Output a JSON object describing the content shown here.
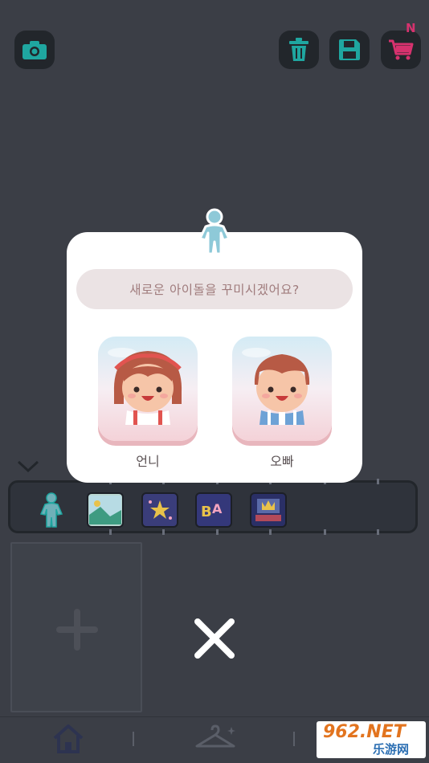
{
  "toolbar": {
    "camera_icon": "camera-icon",
    "trash_icon": "trash-icon",
    "save_icon": "floppy-disk-icon",
    "cart_icon": "shopping-cart-icon",
    "cart_badge": "N",
    "accent_camera": "#1fa6a0",
    "accent_cart": "#d6326e"
  },
  "modal": {
    "question": "새로운 아이돌을 꾸미시겠어요?",
    "options": [
      {
        "label": "언니",
        "avatar": "girl-avatar-icon"
      },
      {
        "label": "오빠",
        "avatar": "boy-avatar-icon"
      }
    ]
  },
  "tray": {
    "items": [
      "figure-icon",
      "background-image-icon",
      "stars-icon",
      "letters-icon",
      "stage-icon"
    ]
  },
  "close_icon": "close-icon",
  "bottom_nav": {
    "items": [
      "home-icon",
      "hanger-icon"
    ]
  },
  "watermark": {
    "top": "962.NET",
    "bottom": "乐游网"
  }
}
